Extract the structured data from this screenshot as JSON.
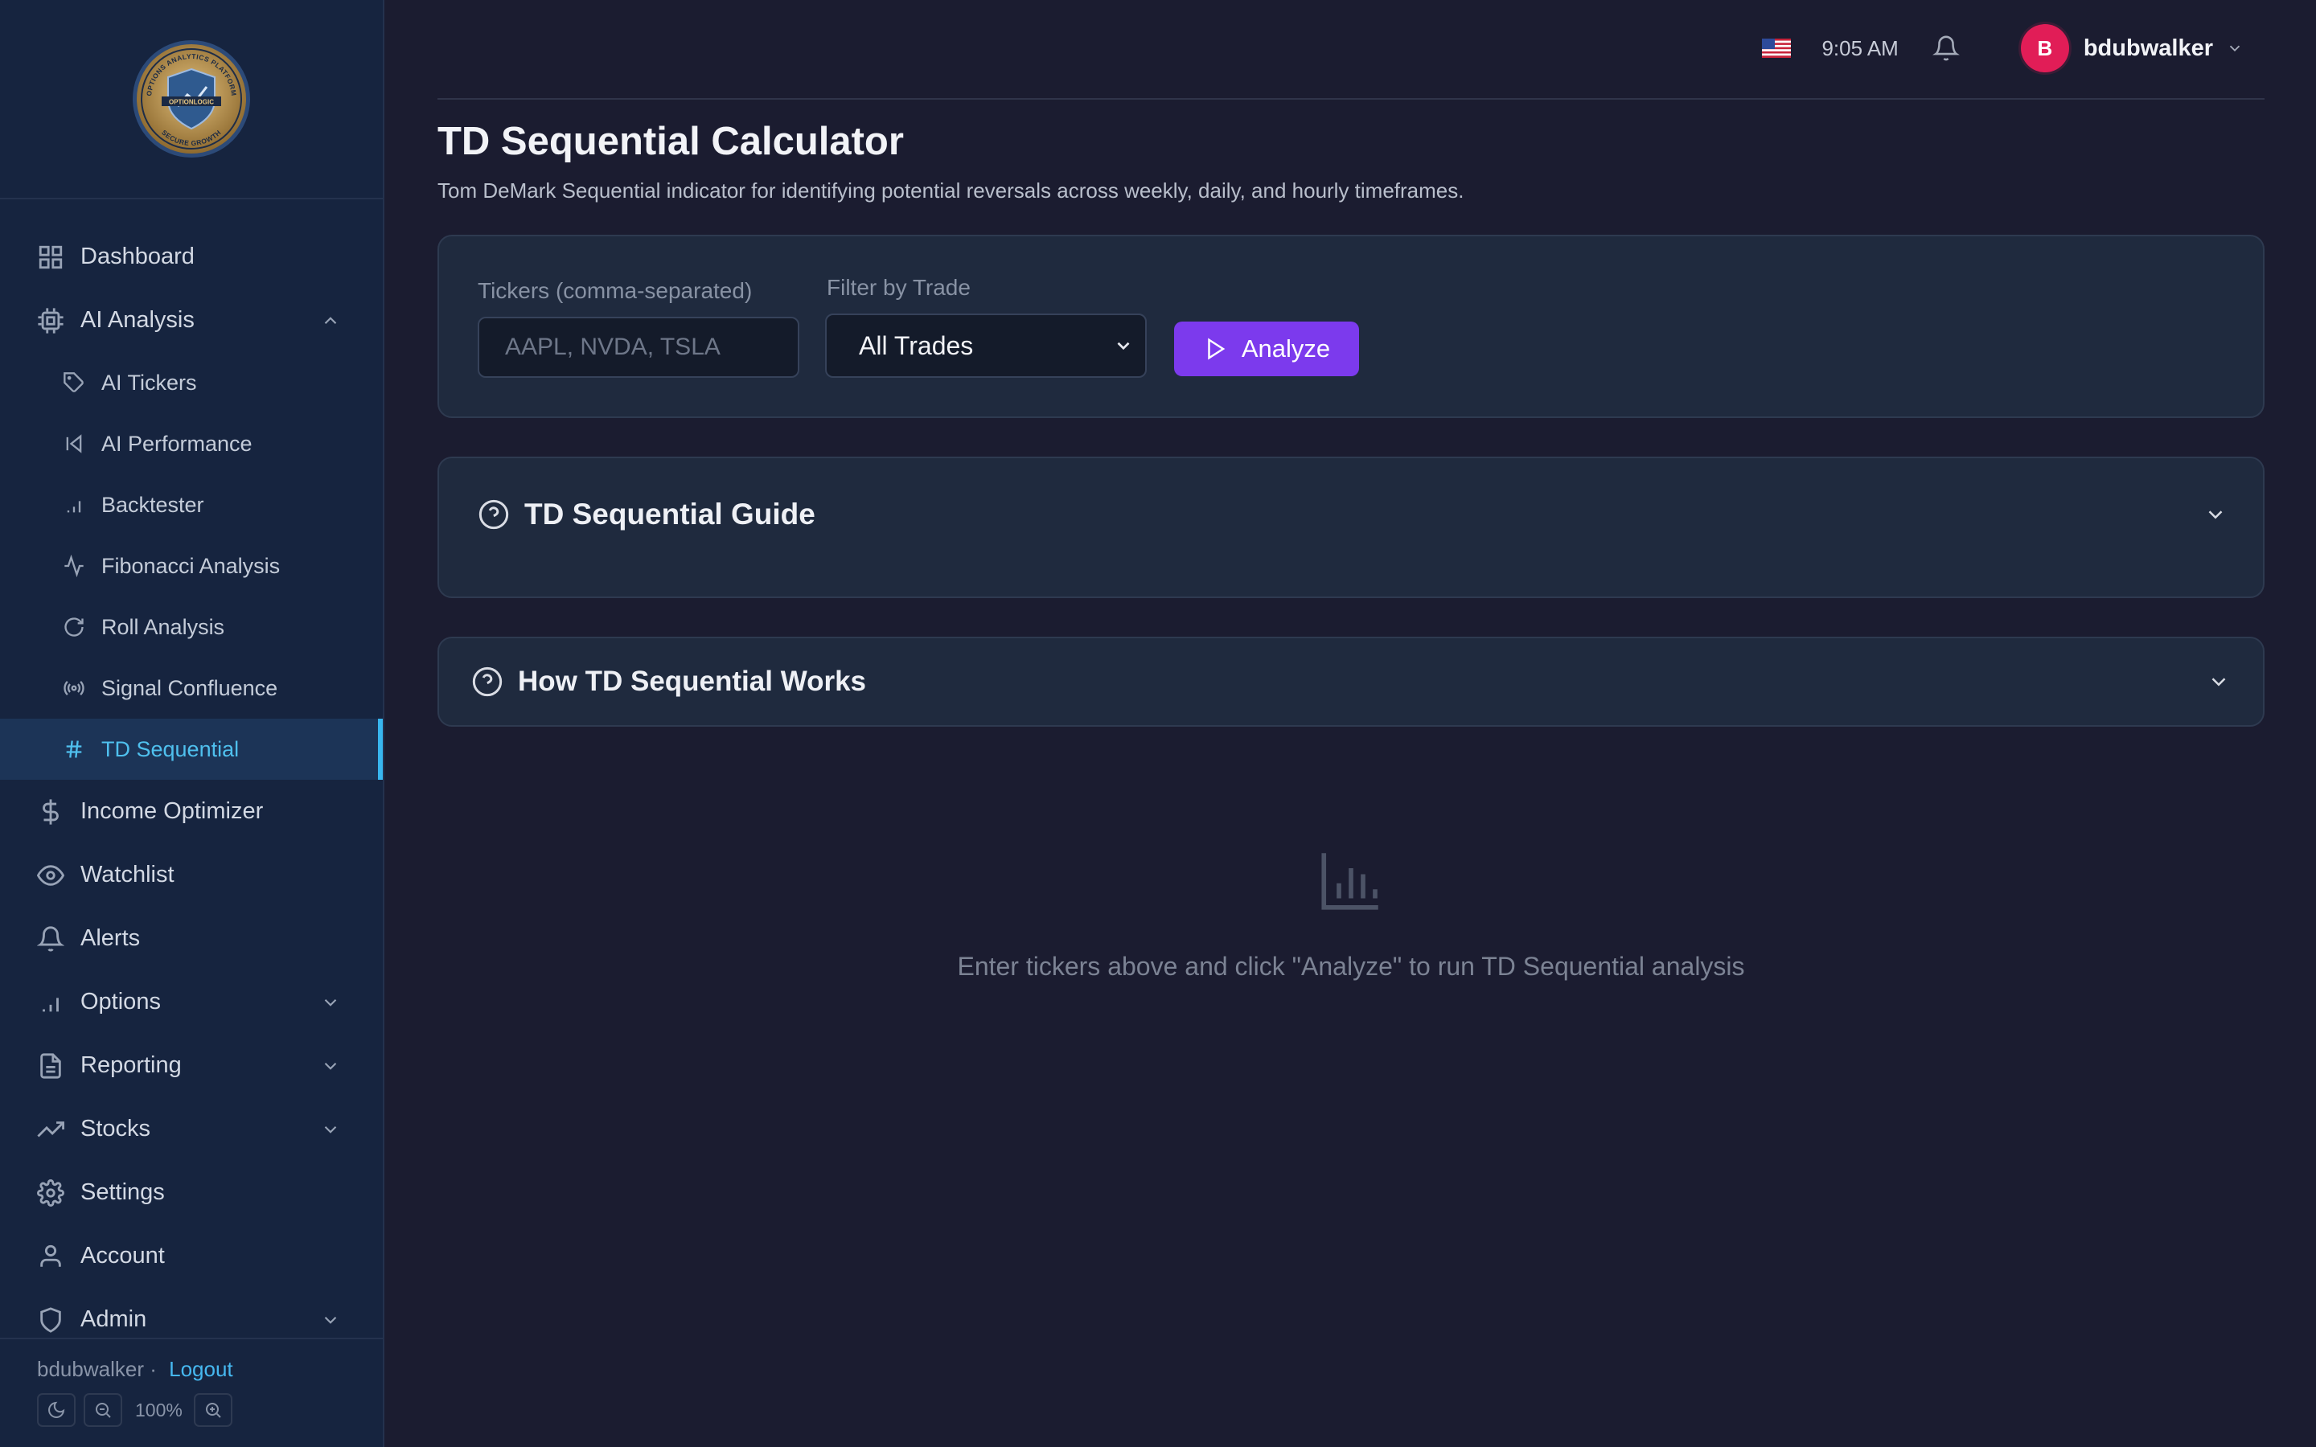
{
  "sidebar": {
    "logo": {
      "ring_text_top": "OPTIONS ANALYTICS PLATFORM",
      "center_text": "OPTIONLOGIC",
      "ring_text_bottom": "SECURE GROWTH"
    },
    "items": [
      {
        "label": "Dashboard",
        "icon": "grid-icon"
      },
      {
        "label": "AI Analysis",
        "icon": "cpu-icon",
        "expanded": true
      },
      {
        "label": "AI Tickers",
        "icon": "tag-icon"
      },
      {
        "label": "AI Performance",
        "icon": "skip-back-icon"
      },
      {
        "label": "Backtester",
        "icon": "bar-chart-icon"
      },
      {
        "label": "Fibonacci Analysis",
        "icon": "activity-icon"
      },
      {
        "label": "Roll Analysis",
        "icon": "refresh-icon"
      },
      {
        "label": "Signal Confluence",
        "icon": "radio-icon"
      },
      {
        "label": "TD Sequential",
        "icon": "hash-icon",
        "active": true
      },
      {
        "label": "Income Optimizer",
        "icon": "dollar-icon"
      },
      {
        "label": "Watchlist",
        "icon": "eye-icon"
      },
      {
        "label": "Alerts",
        "icon": "bell-icon"
      },
      {
        "label": "Options",
        "icon": "bar-chart-icon"
      },
      {
        "label": "Reporting",
        "icon": "file-icon"
      },
      {
        "label": "Stocks",
        "icon": "trending-up-icon"
      },
      {
        "label": "Settings",
        "icon": "gear-icon"
      },
      {
        "label": "Account",
        "icon": "user-icon"
      },
      {
        "label": "Admin",
        "icon": "shield-icon"
      }
    ],
    "footer": {
      "username": "bdubwalker",
      "separator": "·",
      "logout_label": "Logout",
      "zoom": "100%"
    }
  },
  "topbar": {
    "flag": "us-flag-icon",
    "time": "9:05 AM",
    "avatar_initial": "B",
    "username": "bdubwalker"
  },
  "main": {
    "title": "TD Sequential Calculator",
    "subtitle": "Tom DeMark Sequential indicator for identifying potential reversals across weekly, daily, and hourly timeframes.",
    "controls": {
      "tickers_label": "Tickers (comma-separated)",
      "tickers_placeholder": "AAPL, NVDA, TSLA",
      "tickers_value": "",
      "filter_label": "Filter by Trade",
      "filter_value": "All Trades",
      "analyze_label": "Analyze"
    },
    "guide_title": "TD Sequential Guide",
    "how_title": "How TD Sequential Works",
    "empty_text": "Enter tickers above and click \"Analyze\" to run TD Sequential analysis"
  },
  "colors": {
    "background": "#1b1c30",
    "sidebar": "#16243f",
    "accent": "#7c3aed",
    "active_nav": "#4fc0ee",
    "avatar": "#e11d57",
    "card": "#1f2a3e"
  }
}
